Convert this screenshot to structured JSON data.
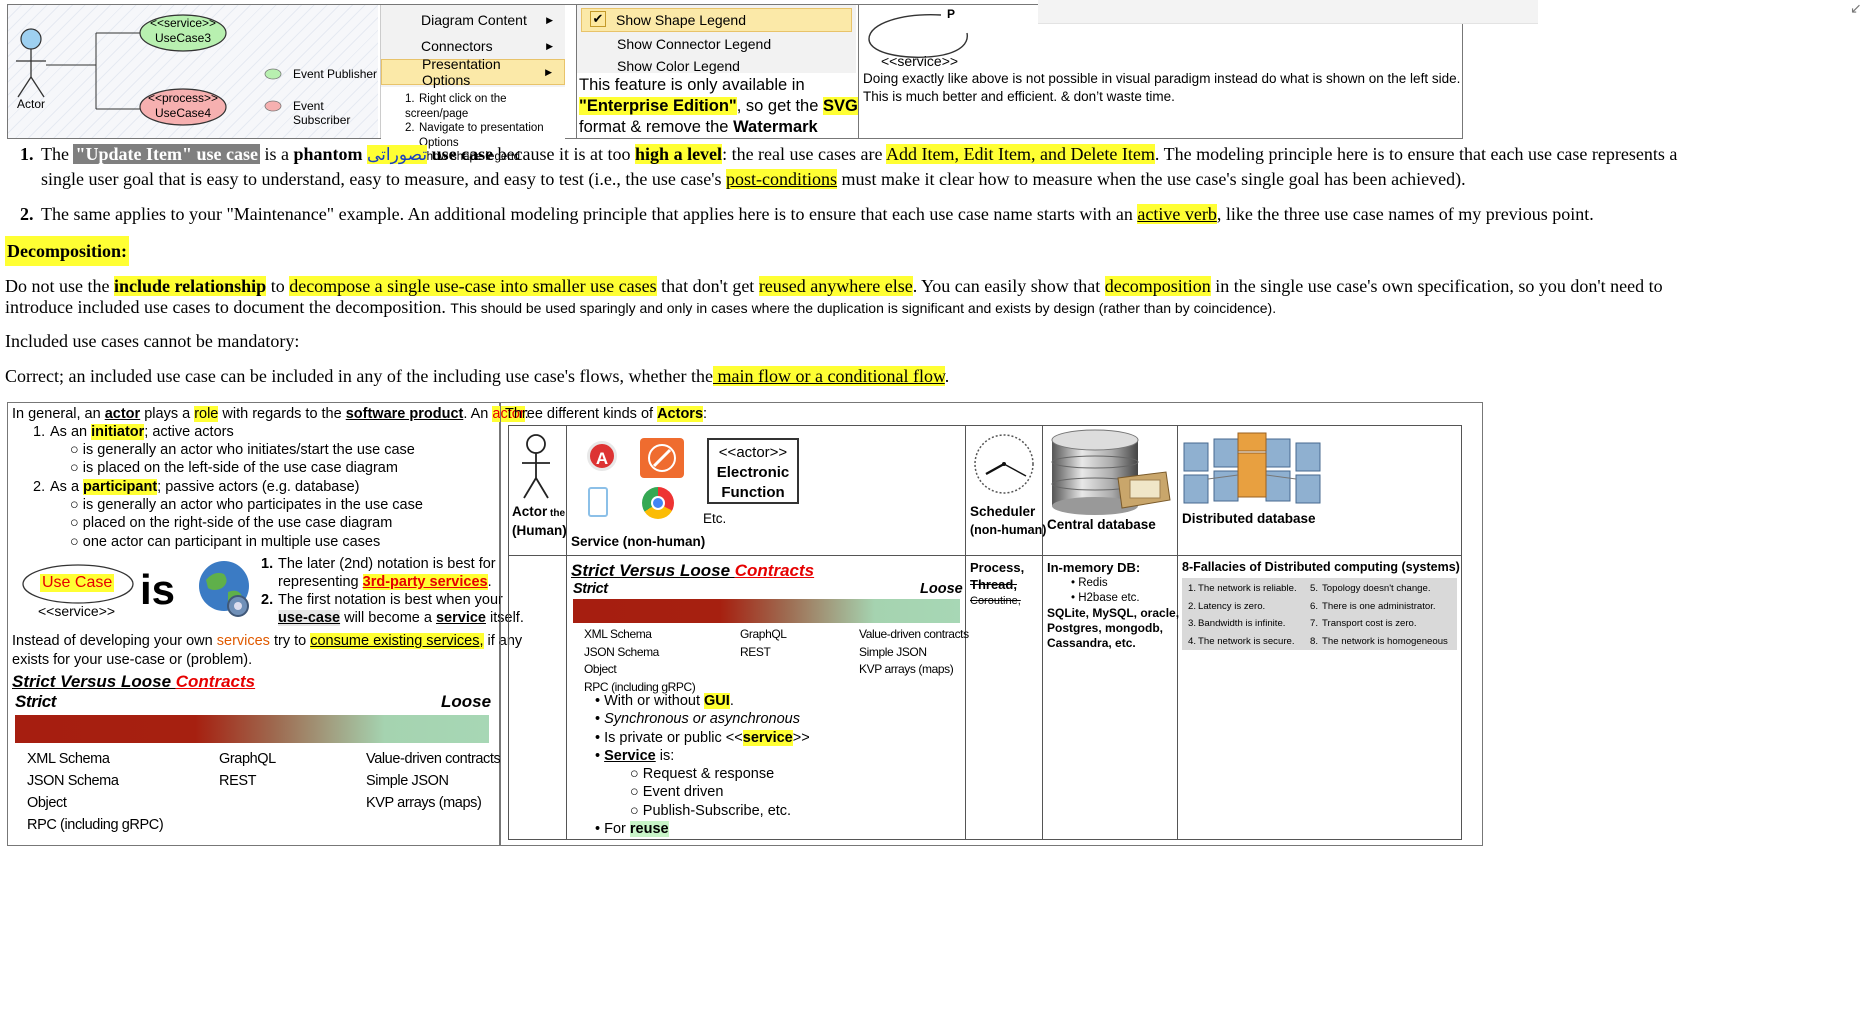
{
  "top": {
    "diagram": {
      "service_stereo": "<<service>>",
      "service_name": "UseCase3",
      "process_stereo": "<<process>>",
      "process_name": "UseCase4",
      "actor_label": "Actor",
      "legend_publisher": "Event Publisher",
      "legend_subscriber": "Event Subscriber"
    },
    "menu": {
      "items": [
        "Diagram Content",
        "Connectors",
        "Presentation Options"
      ],
      "steps": [
        "Right click on the screen/page",
        "Navigate to presentation",
        "Options",
        "Show shape legend"
      ],
      "step_numbers": [
        "1.",
        "2.",
        "3."
      ]
    },
    "submenu": {
      "items": [
        "Show Shape Legend",
        "Show Connector Legend",
        "Show Color Legend"
      ],
      "feature_text_1": "This feature is only available in",
      "feature_edition": "\"Enterprise Edition\"",
      "feature_text_2": ", so get the ",
      "feature_svg": "SVG",
      "feature_text_3": "format & remove the ",
      "feature_watermark": "Watermark"
    },
    "right": {
      "p_label": "P",
      "stereo": "<<service>>",
      "note_1": "Doing exactly like above is not possible in visual paradigm instead do what is shown  on the left side.",
      "note_2": "This is much better and efficient. & don’t waste time."
    }
  },
  "points": {
    "p1": {
      "num": "1.",
      "t1": "The ",
      "t2": "\"Update Item\" use case",
      "t3": " is a ",
      "t4": "phantom",
      "t5": " ",
      "t6": "تصوراتی",
      "t7": " use case",
      "t8": " because it is at too ",
      "t9": "high a level",
      "t10": ": the real use cases are ",
      "t11": "Add Item, Edit Item, and Delete Item",
      "t12": ". The modeling principle here is to ensure that each use case represents a",
      "line2a": "single user goal that is easy to understand, easy to measure, and easy to test (i.e., the use case's ",
      "line2b": "post-conditions",
      "line2c": " must make it clear how to measure when the use case's single goal has been achieved)."
    },
    "p2": {
      "num": "2.",
      "t1": "The same applies to your \"Maintenance\" example. An additional modeling principle that applies here is to ensure that each use case name starts with an ",
      "t2": "active verb",
      "t3": ", like the three use case names of my previous point."
    }
  },
  "decomposition": {
    "heading": "Decomposition:",
    "l1a": "Do not use the ",
    "l1b": "include relationship",
    "l1c": " to ",
    "l1d": "decompose a single use-case into smaller use cases",
    "l1e": " that don't get ",
    "l1f": "reused anywhere else",
    "l1g": ". You can easily show that ",
    "l1h": "decomposition",
    "l1i": " in the single use case's own specification, so you don't need to",
    "l2a": "introduce included use cases to document the decomposition. ",
    "l2b": "This should be used sparingly and only in cases where the duplication is significant and exists by design (rather than by coincidence).",
    "l3": "Included use cases cannot be mandatory:",
    "l4a": "Correct; an included use case can be included in any of the including use case's flows, whether the",
    "l4b": " main flow or a conditional flow",
    "l4c": "."
  },
  "left_panel": {
    "intro_a": "In general, an ",
    "intro_actor": "actor",
    "intro_b": " plays a ",
    "intro_role": "role",
    "intro_c": " with regards to the ",
    "intro_sw": "software product",
    "intro_d": ". An ",
    "intro_actor2": "actor",
    "intro_e": ":",
    "n1": "1.",
    "item1_a": "As an ",
    "item1_b": "initiator",
    "item1_c": "; active actors",
    "item1_sub": [
      "is generally an actor who initiates/start the use case",
      "is placed on the left-side of the use case diagram"
    ],
    "n2": "2.",
    "item2_a": "As a ",
    "item2_b": "participant",
    "item2_c": "; passive actors (e.g. database)",
    "item2_sub": [
      "is generally an actor who participates in the use case",
      "placed on the right-side of the use case diagram",
      "one actor can participant in multiple use cases"
    ],
    "usecase_label": "Use Case",
    "usecase_stereo": "<<service>>",
    "is_label": "is",
    "note1_num": "1.",
    "note1_a": "The later (2nd) notation is best for",
    "note1_b": "representing ",
    "note1_c": "3rd-party services",
    "note1_d": ".",
    "note2_num": "2.",
    "note2_a": "The first notation is best when your",
    "note2_b": "use-case",
    "note2_c": " will become a ",
    "note2_d": "service",
    "note2_e": " itself.",
    "consume_a": "Instead of developing your own ",
    "consume_b": "services",
    "consume_c": " try to ",
    "consume_d": "consume existing services,",
    "consume_e": " if any",
    "consume_f": "exists for your use-case or (problem).",
    "svl_a": "Strict Versus Loose ",
    "svl_b": "Contracts",
    "strict": "Strict",
    "loose": "Loose",
    "col1": [
      "XML Schema",
      "JSON Schema",
      "Object",
      "RPC (including gRPC)"
    ],
    "col2": [
      "GraphQL",
      "REST"
    ],
    "col3": [
      "Value-driven contracts",
      "Simple JSON",
      "KVP arrays (maps)"
    ]
  },
  "right_panel": {
    "heading_a": "Three different kinds of ",
    "heading_b": "Actors",
    "heading_c": ":",
    "actor_human_a": "Actor",
    "actor_human_b": " the",
    "actor_human_c": "(Human)",
    "elec_1": "<<actor>>",
    "elec_2": "Electronic",
    "elec_3": "Function",
    "etc": "Etc.",
    "service_nonhuman": "Service (non-human)",
    "scheduler": "Scheduler",
    "scheduler_sub": "(non-human)",
    "central_db": "Central database",
    "distributed_db": "Distributed database",
    "svl_a": "Strict Versus Loose ",
    "svl_b": "Contracts",
    "strict": "Strict",
    "loose": "Loose",
    "c1": [
      "XML Schema",
      "JSON Schema",
      "Object",
      "RPC (including gRPC)"
    ],
    "c2": [
      "GraphQL",
      "REST"
    ],
    "c3": [
      "Value-driven contracts",
      "Simple JSON",
      "KVP arrays (maps)"
    ],
    "b1a": "With or without ",
    "b1b": "GUI",
    "b1c": ".",
    "b2": "Synchronous or asynchronous",
    "b3a": "Is private or public <<",
    "b3b": "service",
    "b3c": ">>",
    "b4a": "Service",
    "b4b": " is:",
    "b4sub": [
      "Request & response",
      "Event driven",
      "Publish-Subscribe, etc."
    ],
    "b5a": "For ",
    "b5b": "reuse",
    "process_title": "Process,",
    "process_thread": "Thread,",
    "process_coroutine": "Coroutine,",
    "inmem_title": "In-memory DB:",
    "inmem_items": [
      "Redis",
      "H2base etc."
    ],
    "inmem_more": [
      "SQLite, MySQL, oracle,",
      "Postgres, mongodb,",
      "Cassandra, etc."
    ],
    "fallacies_title": "8-Fallacies of Distributed computing (systems)",
    "fallacies": [
      [
        "1.",
        "The network is reliable.",
        "5.",
        "Topology doesn't change."
      ],
      [
        "2.",
        "Latency is zero.",
        "6.",
        "There is one administrator."
      ],
      [
        "3.",
        "Bandwidth is infinite.",
        "7.",
        "Transport cost is zero."
      ],
      [
        "4.",
        "The network is secure.",
        "8.",
        "The network is homogeneous"
      ]
    ]
  },
  "colors": {
    "highlight": "#ffff33",
    "green_highlight": "#c8f5c8",
    "red_text": "#e60000",
    "gray_label": "#7f7f7f",
    "gradient_strict": "#a61e10",
    "gradient_loose": "#a7d7b5"
  }
}
